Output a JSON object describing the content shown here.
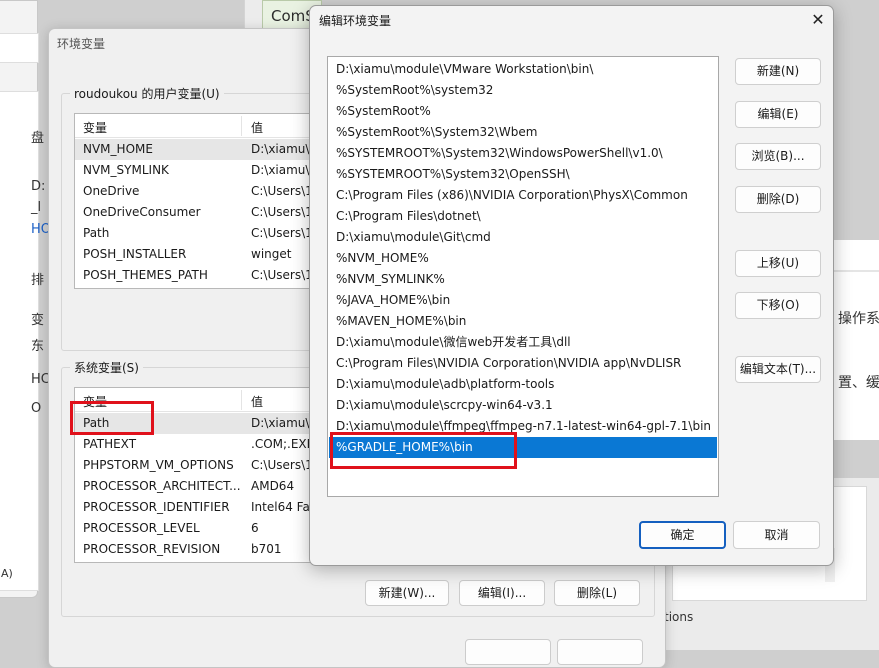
{
  "background_left": {
    "texts": [
      "盘",
      "D:",
      "_l",
      "HO",
      "排",
      "变",
      "东",
      "HC",
      "O",
      "A)"
    ]
  },
  "background_top_editor": {
    "text": "ComS"
  },
  "background_right": {
    "text_a": "操作系",
    "text_b": "置、缓",
    "text_c": "tions"
  },
  "env_window": {
    "title": "环境变量",
    "user_group": {
      "label": "roudoukou 的用户变量(U)",
      "col_variable": "变量",
      "col_value": "值",
      "rows": [
        {
          "name": "NVM_HOME",
          "value": "D:\\xiamu\\m"
        },
        {
          "name": "NVM_SYMLINK",
          "value": "D:\\xiamu\\m"
        },
        {
          "name": "OneDrive",
          "value": "C:\\Users\\1"
        },
        {
          "name": "OneDriveConsumer",
          "value": "C:\\Users\\1"
        },
        {
          "name": "Path",
          "value": "C:\\Users\\1"
        },
        {
          "name": "POSH_INSTALLER",
          "value": "winget"
        },
        {
          "name": "POSH_THEMES_PATH",
          "value": "C:\\Users\\1"
        }
      ]
    },
    "system_group": {
      "label": "系统变量(S)",
      "col_variable": "变量",
      "col_value": "值",
      "rows": [
        {
          "name": "Path",
          "value": "D:\\xiamu\\m"
        },
        {
          "name": "PATHEXT",
          "value": ".COM;.EXE"
        },
        {
          "name": "PHPSTORM_VM_OPTIONS",
          "value": "C:\\Users\\1"
        },
        {
          "name": "PROCESSOR_ARCHITECT...",
          "value": "AMD64"
        },
        {
          "name": "PROCESSOR_IDENTIFIER",
          "value": "Intel64 Far"
        },
        {
          "name": "PROCESSOR_LEVEL",
          "value": "6"
        },
        {
          "name": "PROCESSOR_REVISION",
          "value": "b701"
        }
      ],
      "new_label": "新建(W)...",
      "edit_label": "编辑(I)...",
      "delete_label": "删除(L)"
    }
  },
  "edit_dialog": {
    "title": "编辑环境变量",
    "close_glyph": "✕",
    "paths": [
      "D:\\xiamu\\module\\VMware Workstation\\bin\\",
      "%SystemRoot%\\system32",
      "%SystemRoot%",
      "%SystemRoot%\\System32\\Wbem",
      "%SYSTEMROOT%\\System32\\WindowsPowerShell\\v1.0\\",
      "%SYSTEMROOT%\\System32\\OpenSSH\\",
      "C:\\Program Files (x86)\\NVIDIA Corporation\\PhysX\\Common",
      "C:\\Program Files\\dotnet\\",
      "D:\\xiamu\\module\\Git\\cmd",
      "%NVM_HOME%",
      "%NVM_SYMLINK%",
      "%JAVA_HOME%\\bin",
      "%MAVEN_HOME%\\bin",
      "D:\\xiamu\\module\\微信web开发者工具\\dll",
      "C:\\Program Files\\NVIDIA Corporation\\NVIDIA app\\NvDLISR",
      "D:\\xiamu\\module\\adb\\platform-tools",
      "D:\\xiamu\\module\\scrcpy-win64-v3.1",
      "D:\\xiamu\\module\\ffmpeg\\ffmpeg-n7.1-latest-win64-gpl-7.1\\bin",
      "%GRADLE_HOME%\\bin"
    ],
    "selected_index": 18,
    "buttons": {
      "new": "新建(N)",
      "edit": "编辑(E)",
      "browse": "浏览(B)...",
      "delete": "删除(D)",
      "move_up": "上移(U)",
      "move_down": "下移(O)",
      "edit_text": "编辑文本(T)...",
      "ok": "确定",
      "cancel": "取消"
    }
  },
  "colors": {
    "selection": "#0a78d4",
    "annotation": "#e0111b",
    "ok_border": "#1560c0"
  }
}
